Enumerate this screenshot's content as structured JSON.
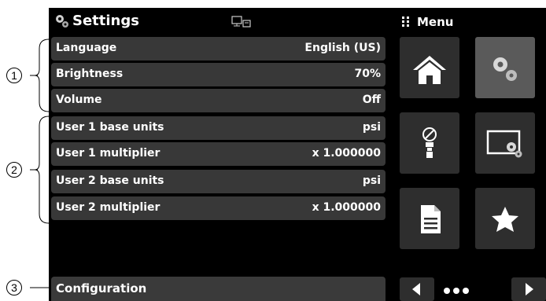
{
  "header": {
    "title": "Settings",
    "menu_label": "Menu"
  },
  "rows": [
    {
      "label": "Language",
      "value": "English (US)"
    },
    {
      "label": "Brightness",
      "value": "70%"
    },
    {
      "label": "Volume",
      "value": "Off"
    },
    {
      "label": "User 1 base units",
      "value": "psi"
    },
    {
      "label": "User 1 multiplier",
      "value": "x 1.000000"
    },
    {
      "label": "User 2 base units",
      "value": "psi"
    },
    {
      "label": "User 2 multiplier",
      "value": "x 1.000000"
    }
  ],
  "footer": {
    "label": "Configuration"
  },
  "menu_tiles": [
    {
      "icon": "home-icon"
    },
    {
      "icon": "gears-icon",
      "selected": true
    },
    {
      "icon": "sensor-icon"
    },
    {
      "icon": "monitor-settings-icon"
    },
    {
      "icon": "document-icon"
    },
    {
      "icon": "star-icon"
    }
  ],
  "callouts": [
    "1",
    "2",
    "3"
  ],
  "colors": {
    "background": "#000000",
    "row": "#383838",
    "tile": "#2e2e2e",
    "tile_selected": "#5a5a5a",
    "text": "#ffffff"
  }
}
